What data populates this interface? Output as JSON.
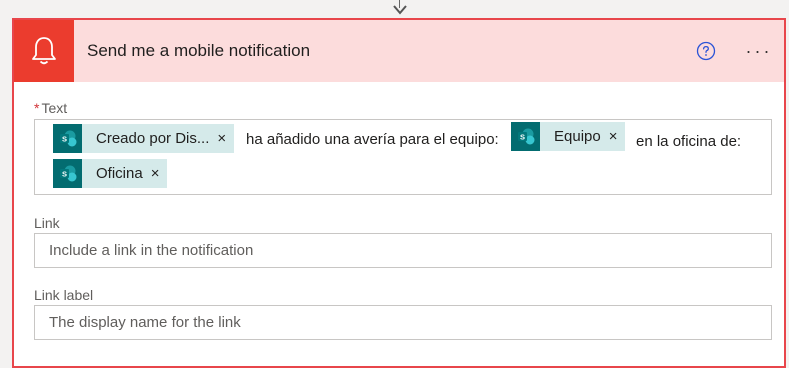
{
  "action_card": {
    "title": "Send me a mobile notification",
    "icon": "bell-icon",
    "help_icon": "help-icon",
    "more_label": "···",
    "accent_color": "#eb3c2e",
    "header_bg": "#fcdcdc"
  },
  "text_field": {
    "label": "Text",
    "required_mark": "*",
    "content": {
      "token_creado": "Creado por Dis...",
      "segment_1": "ha añadido una avería para el equipo:",
      "token_equipo": "Equipo",
      "segment_2": "en la oficina de:",
      "token_oficina": "Oficina"
    },
    "remove_symbol": "×",
    "token_icon": "sharepoint-icon",
    "token_icon_color": "#036c70"
  },
  "link_field": {
    "label": "Link",
    "placeholder": "Include a link in the notification"
  },
  "link_label_field": {
    "label": "Link label",
    "placeholder": "The display name for the link"
  }
}
